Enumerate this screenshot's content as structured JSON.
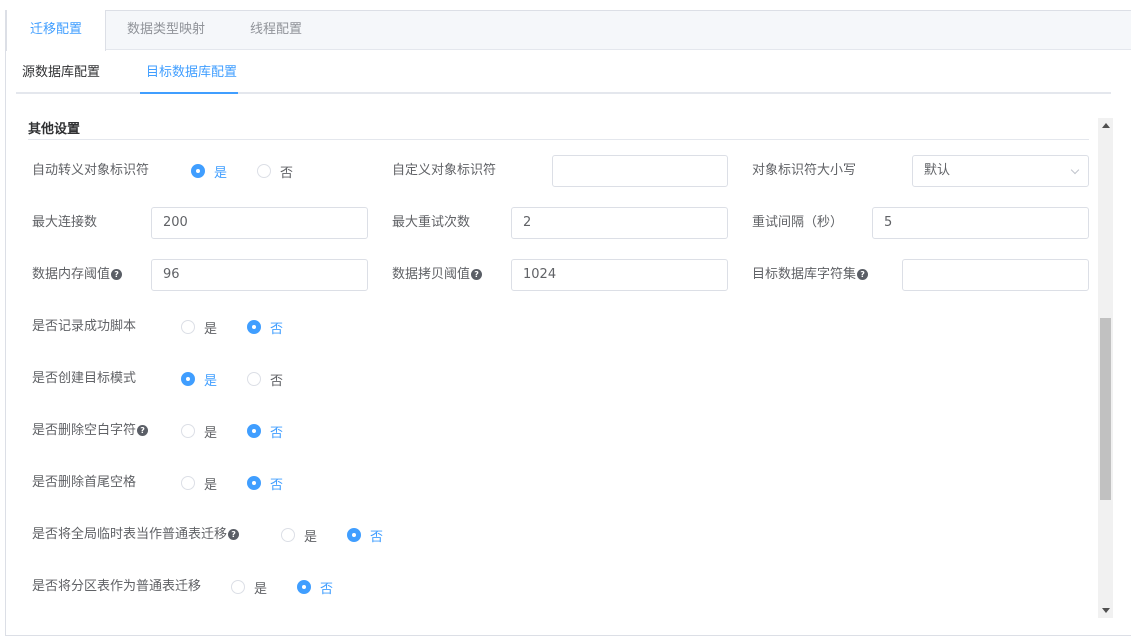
{
  "top_tabs": [
    "迁移配置",
    "数据类型映射",
    "线程配置"
  ],
  "sub_tabs": [
    "源数据库配置",
    "目标数据库配置"
  ],
  "section_title": "其他设置",
  "fields": {
    "auto_escape": {
      "label": "自动转义对象标识符",
      "options": [
        "是",
        "否"
      ],
      "selected": "是"
    },
    "custom_identifier": {
      "label": "自定义对象标识符",
      "value": ""
    },
    "identifier_case": {
      "label": "对象标识符大小写",
      "value": "默认"
    },
    "max_connections": {
      "label": "最大连接数",
      "value": "200"
    },
    "max_retries": {
      "label": "最大重试次数",
      "value": "2"
    },
    "retry_interval": {
      "label": "重试间隔（秒）",
      "value": "5"
    },
    "memory_threshold": {
      "label": "数据内存阈值",
      "value": "96"
    },
    "copy_threshold": {
      "label": "数据拷贝阈值",
      "value": "1024"
    },
    "target_charset": {
      "label": "目标数据库字符集",
      "value": ""
    },
    "log_success_script": {
      "label": "是否记录成功脚本",
      "options": [
        "是",
        "否"
      ],
      "selected": "否"
    },
    "create_target_schema": {
      "label": "是否创建目标模式",
      "options": [
        "是",
        "否"
      ],
      "selected": "是"
    },
    "remove_whitespace": {
      "label": "是否删除空白字符",
      "options": [
        "是",
        "否"
      ],
      "selected": "否"
    },
    "trim_spaces": {
      "label": "是否删除首尾空格",
      "options": [
        "是",
        "否"
      ],
      "selected": "否"
    },
    "global_temp_as_normal": {
      "label": "是否将全局临时表当作普通表迁移",
      "options": [
        "是",
        "否"
      ],
      "selected": "否"
    },
    "partition_as_normal": {
      "label": "是否将分区表作为普通表迁移",
      "options": [
        "是",
        "否"
      ],
      "selected": "否"
    }
  },
  "help_icon_text": "?"
}
